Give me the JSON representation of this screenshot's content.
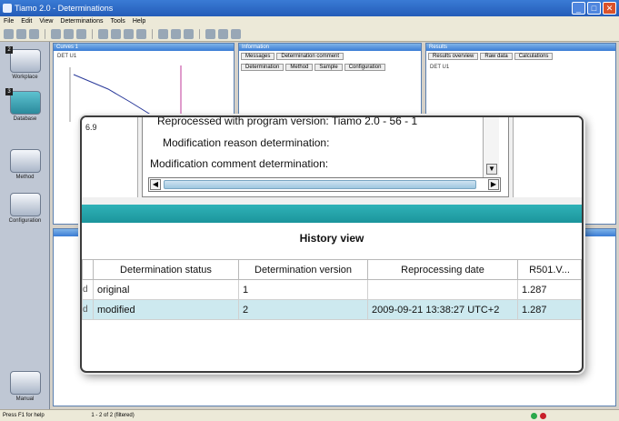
{
  "app": {
    "title": "Tiamo 2.0 - Determinations",
    "menu": [
      "File",
      "Edit",
      "View",
      "Determinations",
      "Tools",
      "Help"
    ],
    "window_controls": [
      "minimize-icon",
      "maximize-icon",
      "close-icon"
    ]
  },
  "sidebar": {
    "items": [
      {
        "label": "Workplace",
        "icon": "workplace-icon",
        "num": "2"
      },
      {
        "label": "Database",
        "icon": "database-icon",
        "num": "3"
      },
      {
        "label": "Method",
        "icon": "method-icon",
        "num": ""
      },
      {
        "label": "Configuration",
        "icon": "configuration-icon",
        "num": ""
      }
    ],
    "manual": "Manual"
  },
  "panes": {
    "curves": {
      "title": "Curves 1",
      "subtitle": "DET U1"
    },
    "information": {
      "title": "Information",
      "tabs_top": [
        "Messages",
        "Determination comment"
      ],
      "tabs_bottom": [
        "Determination",
        "Method",
        "Sample",
        "Configuration"
      ]
    },
    "results": {
      "title": "Results",
      "tabs": [
        "Results overview",
        "Raw data",
        "Calculations"
      ],
      "subtitle": "DET U1"
    }
  },
  "overlay": {
    "left_value": "6.9",
    "line1_prefix": "Reprocessed with program version:",
    "line1_value": "Tiamo 2.0 - 56 - 1",
    "line2": "Modification reason determination:",
    "line3": "Modification comment determination:",
    "history_title": "History view",
    "columns": [
      "Determination status",
      "Determination version",
      "Reprocessing date",
      "R501.V..."
    ],
    "rows": [
      {
        "marker": "d",
        "status": "original",
        "version": "1",
        "date": "",
        "value": "1.287",
        "selected": false
      },
      {
        "marker": "d",
        "status": "modified",
        "version": "2",
        "date": "2009-09-21 13:38:27 UTC+2",
        "value": "1.287",
        "selected": true
      }
    ]
  },
  "statusbar": {
    "text": "Press F1 for help",
    "record_nav": "1 - 2 of 2 (filtered)"
  }
}
